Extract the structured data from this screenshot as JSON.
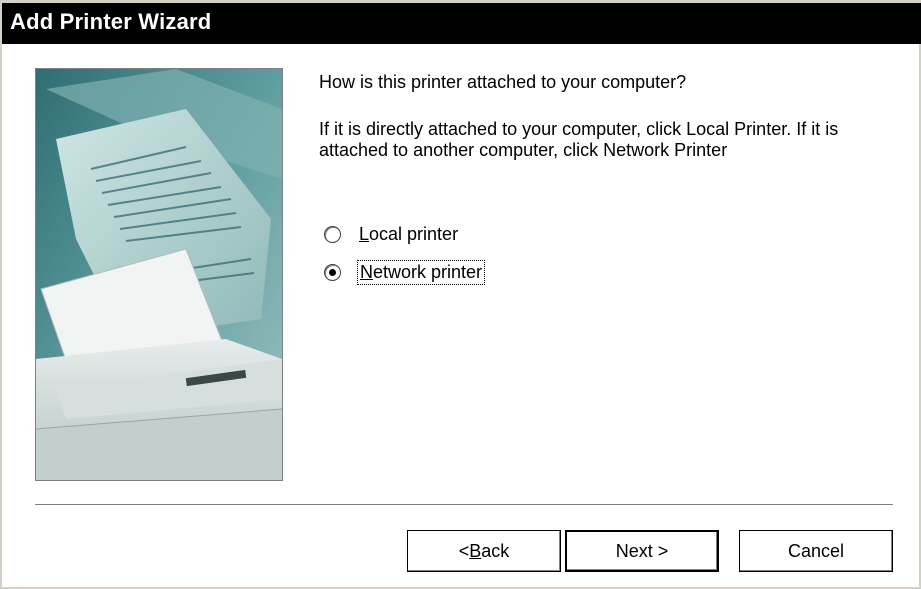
{
  "window": {
    "title": "Add Printer Wizard"
  },
  "illustration": {
    "icon": "printer-with-document-illustration"
  },
  "content": {
    "prompt": "How is this printer attached to your computer?",
    "instructions": "If it is directly attached to your computer, click Local Printer. If it is attached to another computer, click Network Printer",
    "options": [
      {
        "mnemonic": "L",
        "rest": "ocal printer",
        "checked": false
      },
      {
        "mnemonic": "N",
        "rest": "etwork printer",
        "checked": true
      }
    ]
  },
  "buttons": {
    "back": {
      "prefix": "< ",
      "mnemonic": "B",
      "rest": "ack"
    },
    "next": {
      "label": "Next >"
    },
    "cancel": {
      "label": "Cancel"
    }
  },
  "colors": {
    "titlebar": "#000000",
    "title_text": "#ffffff",
    "window_bg": "#ffffff",
    "frame": "#d4d0c8"
  }
}
